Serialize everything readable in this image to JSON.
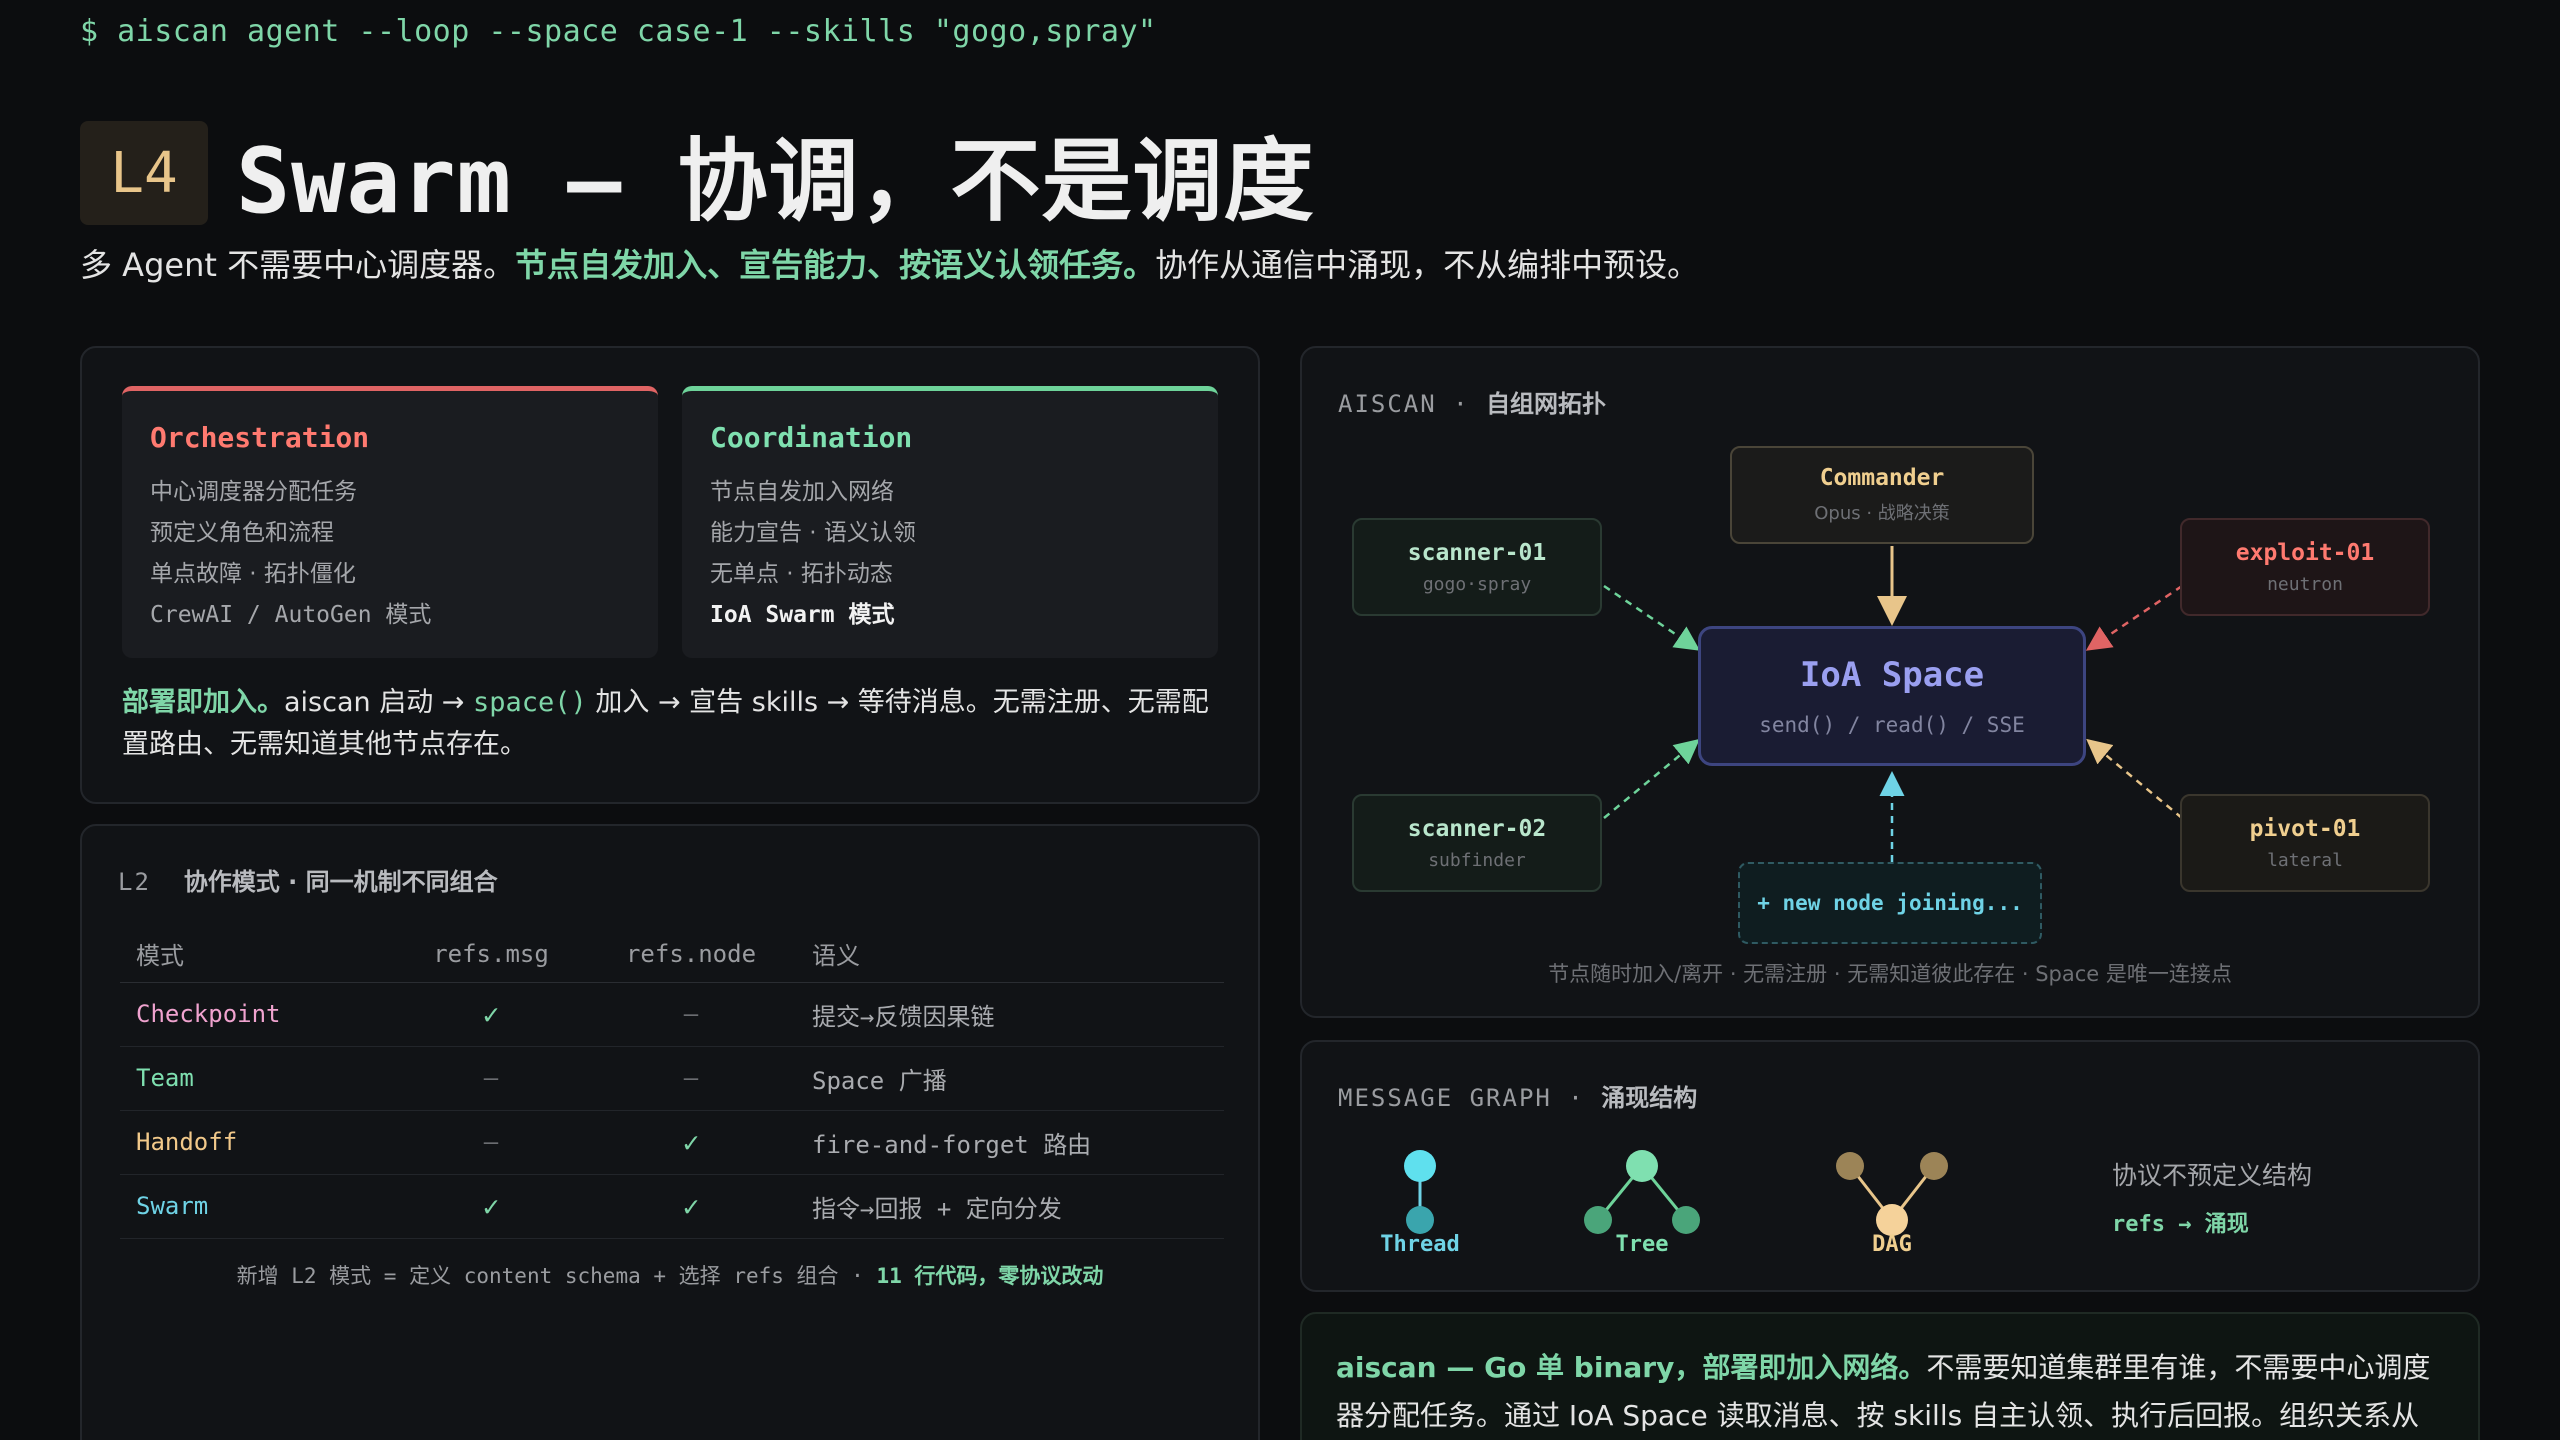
{
  "command": "$ aiscan agent --loop --space case-1 --skills \"gogo,spray\"",
  "header": {
    "badge": "L4",
    "title": "Swarm — 协调，不是调度",
    "subtitle_pre": "多 Agent 不需要中心调度器。",
    "subtitle_hl": "节点自发加入、宣告能力、按语义认领任务。",
    "subtitle_post": "协作从通信中涌现，不从编排中预设。"
  },
  "compare": {
    "orchestration": {
      "title": "Orchestration",
      "lines": [
        "中心调度器分配任务",
        "预定义角色和流程",
        "单点故障 · 拓扑僵化",
        "CrewAI / AutoGen 模式"
      ]
    },
    "coordination": {
      "title": "Coordination",
      "lines": [
        "节点自发加入网络",
        "能力宣告 · 语义认领",
        "无单点 · 拓扑动态",
        "IoA Swarm 模式"
      ]
    },
    "deploy_hl": "部署即加入。",
    "deploy_a": "aiscan 启动 → ",
    "deploy_code": "space()",
    "deploy_b": " 加入 → 宣告 skills → 等待消息。无需注册、无需配置路由、无需知道其他节点存在。"
  },
  "modes": {
    "label_prefix": "L2",
    "label": "协作模式 · 同一机制不同组合",
    "headers": [
      "模式",
      "refs.msg",
      "refs.node",
      "语义"
    ],
    "rows": [
      {
        "mode": "Checkpoint",
        "msg": "✓",
        "node": "—",
        "semantic": "提交→反馈因果链",
        "color": "#f0a3cf"
      },
      {
        "mode": "Team",
        "msg": "—",
        "node": "—",
        "semantic": "Space 广播",
        "color": "#7fe0b0"
      },
      {
        "mode": "Handoff",
        "msg": "—",
        "node": "✓",
        "semantic": "fire-and-forget 路由",
        "color": "#f2c98a"
      },
      {
        "mode": "Swarm",
        "msg": "✓",
        "node": "✓",
        "semantic": "指令→回报 + 定向分发",
        "color": "#6fd3e6"
      }
    ],
    "footer_pre": "新增 L2 模式 = 定义 content schema + 选择 refs 组合 · ",
    "footer_hl": "11 行代码，零协议改动"
  },
  "topology": {
    "label_prefix": "AISCAN",
    "label": "自组网拓扑",
    "commander": {
      "title": "Commander",
      "sub": "Opus · 战略决策"
    },
    "space": {
      "title": "IoA Space",
      "sub": "send() / read() / SSE"
    },
    "scanner1": {
      "title": "scanner-01",
      "sub": "gogo·spray"
    },
    "scanner2": {
      "title": "scanner-02",
      "sub": "subfinder"
    },
    "exploit": {
      "title": "exploit-01",
      "sub": "neutron"
    },
    "pivot": {
      "title": "pivot-01",
      "sub": "lateral"
    },
    "new_node": "+ new node joining...",
    "caption": "节点随时加入/离开 · 无需注册 · 无需知道彼此存在 · Space 是唯一连接点"
  },
  "message_graph": {
    "label_prefix": "MESSAGE GRAPH",
    "label": "涌现结构",
    "shapes": [
      "Thread",
      "Tree",
      "DAG"
    ],
    "note": "协议不预定义结构",
    "note2": "refs → 涌现"
  },
  "binary": {
    "hl": "aiscan — Go 单 binary，部署即加入网络。",
    "text": "不需要知道集群里有谁，不需要中心调度器分配任务。通过 IoA Space 读取消息、按 skills 自主认领、执行后回报。组织关系从通信中涌"
  }
}
